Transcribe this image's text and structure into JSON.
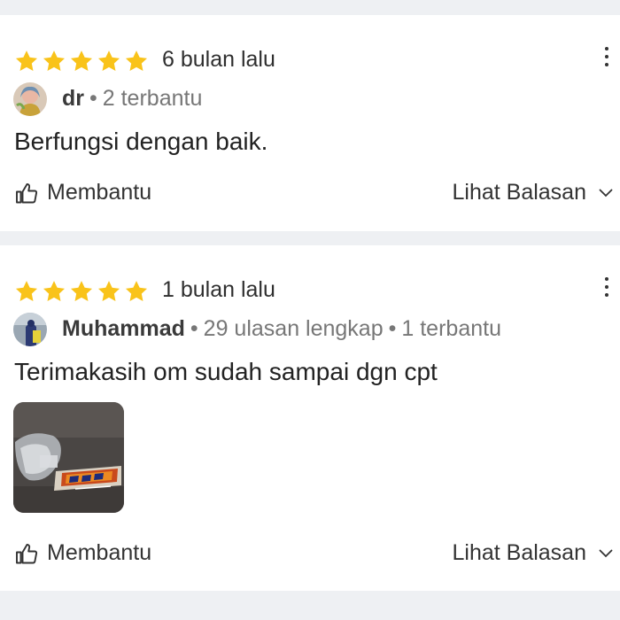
{
  "reviews": [
    {
      "rating": 5,
      "time": "6 bulan lalu",
      "reviewer": "dr",
      "stats": [
        "2 terbantu"
      ],
      "text": "Berfungsi dengan baik.",
      "helpful_label": "Membantu",
      "replies_label": "Lihat Balasan"
    },
    {
      "rating": 5,
      "time": "1 bulan lalu",
      "reviewer": "Muhammad",
      "stats": [
        "29 ulasan lengkap",
        "1 terbantu"
      ],
      "text": "Terimakasih om sudah sampai dgn cpt",
      "helpful_label": "Membantu",
      "replies_label": "Lihat Balasan"
    }
  ],
  "icons": {
    "star": "star-icon",
    "more": "more-vertical-icon",
    "thumb": "thumbs-up-icon",
    "chevron": "chevron-down-icon"
  },
  "colors": {
    "star": "#f9c31a",
    "page_background": "#eef0f3",
    "card_background": "#ffffff"
  }
}
